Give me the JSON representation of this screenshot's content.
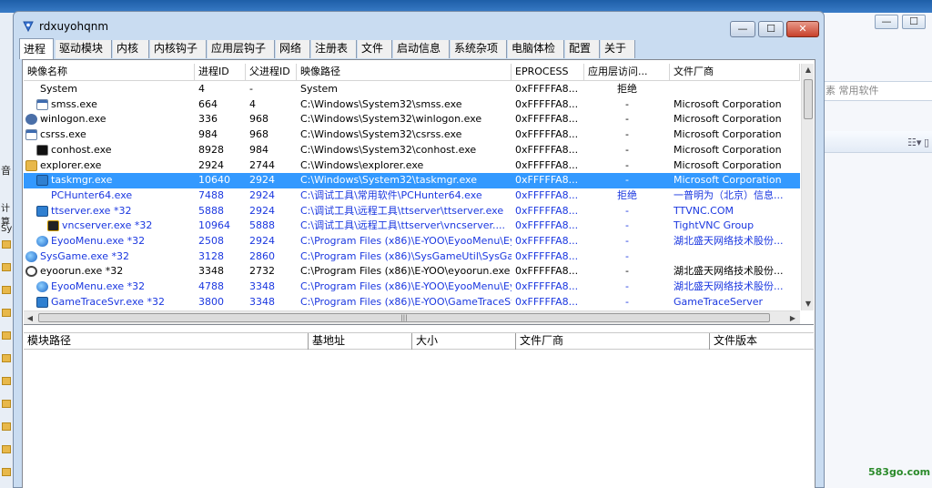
{
  "window": {
    "title": "rdxuyohqnm",
    "minimize_label": "—",
    "maximize_label": "☐",
    "close_label": "✕"
  },
  "tabs": [
    "进程",
    "驱动模块",
    "内核",
    "内核钩子",
    "应用层钩子",
    "网络",
    "注册表",
    "文件",
    "启动信息",
    "系统杂项",
    "电脑体检",
    "配置",
    "关于"
  ],
  "process_table": {
    "columns": [
      "映像名称",
      "进程ID",
      "父进程ID",
      "映像路径",
      "EPROCESS",
      "应用层访问...",
      "文件厂商"
    ],
    "rows": [
      {
        "name": "System",
        "pid": "4",
        "ppid": "-",
        "path": "System",
        "eprocess": "0xFFFFFA8...",
        "access": "拒绝",
        "vendor": "",
        "icon": "none-icon",
        "color": "black"
      },
      {
        "name": "smss.exe",
        "pid": "664",
        "ppid": "4",
        "path": "C:\\Windows\\System32\\smss.exe",
        "eprocess": "0xFFFFFA8...",
        "access": "-",
        "vendor": "Microsoft Corporation",
        "icon": "window-icon",
        "color": "black"
      },
      {
        "name": "winlogon.exe",
        "pid": "336",
        "ppid": "968",
        "path": "C:\\Windows\\System32\\winlogon.exe",
        "eprocess": "0xFFFFFA8...",
        "access": "-",
        "vendor": "Microsoft Corporation",
        "icon": "gear-icon",
        "color": "black"
      },
      {
        "name": "csrss.exe",
        "pid": "984",
        "ppid": "968",
        "path": "C:\\Windows\\System32\\csrss.exe",
        "eprocess": "0xFFFFFA8...",
        "access": "-",
        "vendor": "Microsoft Corporation",
        "icon": "window-icon",
        "color": "black"
      },
      {
        "name": "conhost.exe",
        "pid": "8928",
        "ppid": "984",
        "path": "C:\\Windows\\System32\\conhost.exe",
        "eprocess": "0xFFFFFA8...",
        "access": "-",
        "vendor": "Microsoft Corporation",
        "icon": "console-icon",
        "color": "black"
      },
      {
        "name": "explorer.exe",
        "pid": "2924",
        "ppid": "2744",
        "path": "C:\\Windows\\explorer.exe",
        "eprocess": "0xFFFFFA8...",
        "access": "-",
        "vendor": "Microsoft Corporation",
        "icon": "folder-icon",
        "color": "black"
      },
      {
        "name": "taskmgr.exe",
        "pid": "10640",
        "ppid": "2924",
        "path": "C:\\Windows\\System32\\taskmgr.exe",
        "eprocess": "0xFFFFFA8...",
        "access": "-",
        "vendor": "Microsoft Corporation",
        "icon": "monitor-icon",
        "color": "black",
        "selected": true
      },
      {
        "name": "PCHunter64.exe",
        "pid": "7488",
        "ppid": "2924",
        "path": "C:\\调试工具\\常用软件\\PCHunter64.exe",
        "eprocess": "0xFFFFFA8...",
        "access": "拒绝",
        "vendor": "一普明为（北京）信息...",
        "icon": "none-icon",
        "color": "blue"
      },
      {
        "name": "ttserver.exe *32",
        "pid": "5888",
        "ppid": "2924",
        "path": "C:\\调试工具\\远程工具\\ttserver\\ttserver.exe",
        "eprocess": "0xFFFFFA8...",
        "access": "-",
        "vendor": "TTVNC.COM",
        "icon": "monitor-icon",
        "color": "blue"
      },
      {
        "name": "vncserver.exe *32",
        "pid": "10964",
        "ppid": "5888",
        "path": "C:\\调试工具\\远程工具\\ttserver\\vncserver....",
        "eprocess": "0xFFFFFA8...",
        "access": "-",
        "vendor": "TightVNC Group",
        "icon": "vnc-icon",
        "color": "blue"
      },
      {
        "name": "EyooMenu.exe *32",
        "pid": "2508",
        "ppid": "2924",
        "path": "C:\\Program Files (x86)\\E-YOO\\EyooMenu\\Ey...",
        "eprocess": "0xFFFFFA8...",
        "access": "-",
        "vendor": "湖北盛天网络技术股份...",
        "icon": "globe-icon",
        "color": "blue"
      },
      {
        "name": "SysGame.exe *32",
        "pid": "3128",
        "ppid": "2860",
        "path": "C:\\Program Files (x86)\\SysGameUtil\\SysGam...",
        "eprocess": "0xFFFFFA8...",
        "access": "-",
        "vendor": "",
        "icon": "globe-icon",
        "color": "blue"
      },
      {
        "name": "eyoorun.exe *32",
        "pid": "3348",
        "ppid": "2732",
        "path": "C:\\Program Files (x86)\\E-YOO\\eyoorun.exe",
        "eprocess": "0xFFFFFA8...",
        "access": "-",
        "vendor": "湖北盛天网络技术股份...",
        "icon": "power-icon",
        "color": "black"
      },
      {
        "name": "EyooMenu.exe *32",
        "pid": "4788",
        "ppid": "3348",
        "path": "C:\\Program Files (x86)\\E-YOO\\EyooMenu\\Ey...",
        "eprocess": "0xFFFFFA8...",
        "access": "-",
        "vendor": "湖北盛天网络技术股份...",
        "icon": "globe-icon",
        "color": "blue"
      },
      {
        "name": "GameTraceSvr.exe *32",
        "pid": "3800",
        "ppid": "3348",
        "path": "C:\\Program Files (x86)\\E-YOO\\GameTraceSv...",
        "eprocess": "0xFFFFFA8...",
        "access": "-",
        "vendor": "GameTraceServer",
        "icon": "monitor-icon",
        "color": "blue"
      }
    ]
  },
  "module_table": {
    "columns": [
      "模块路径",
      "基地址",
      "大小",
      "文件厂商",
      "文件版本"
    ]
  },
  "background": {
    "left_texts": [
      "音",
      "计算",
      "Sy"
    ],
    "address_hint": "素 常用软件",
    "watermark": "583go.com"
  },
  "colors": {
    "selection": "#3399ff",
    "blue_text": "#1a37e0",
    "titlebar": "#c9dcf1"
  }
}
